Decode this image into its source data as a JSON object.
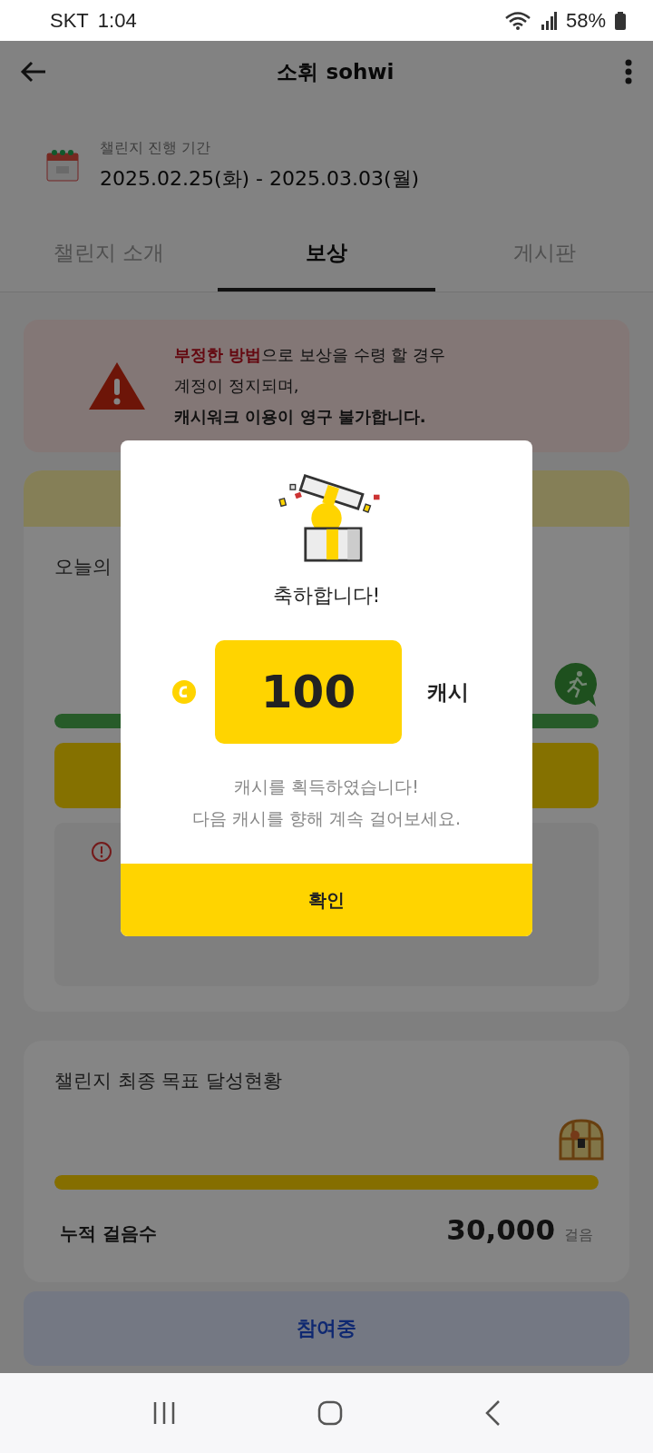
{
  "status_bar": {
    "carrier": "SKT",
    "time": "1:04",
    "battery": "58%"
  },
  "header": {
    "title": "소휘 sohwi"
  },
  "period": {
    "label": "챌린지 진행 기간",
    "dates": "2025.02.25(화) - 2025.03.03(월)"
  },
  "tabs": [
    {
      "label": "챌린지 소개",
      "selected": false
    },
    {
      "label": "보상",
      "selected": true
    },
    {
      "label": "게시판",
      "selected": false
    }
  ],
  "warning": {
    "text": "**부정한 방법**으로 보상을 수령 할 경우\n계정이 정지되며,\n**캐시워크 이용이 영구 불가합니다.**"
  },
  "today_card": {
    "title": "오늘의",
    "level": 1
  },
  "goal_card": {
    "title": "챌린지 최종 목표 달성현황",
    "level": 1,
    "steps_label": "누적 걸음수",
    "steps_value": "30,000",
    "steps_unit": "걸음"
  },
  "bottom_button": {
    "label": "참여중"
  },
  "dialog": {
    "title": "축하합니다!",
    "amount": "100",
    "unit": "캐시",
    "message": "캐시를 획득하였습니다!\n다음 캐시를 향해 계속 걸어보세요.",
    "confirm": "확인"
  }
}
